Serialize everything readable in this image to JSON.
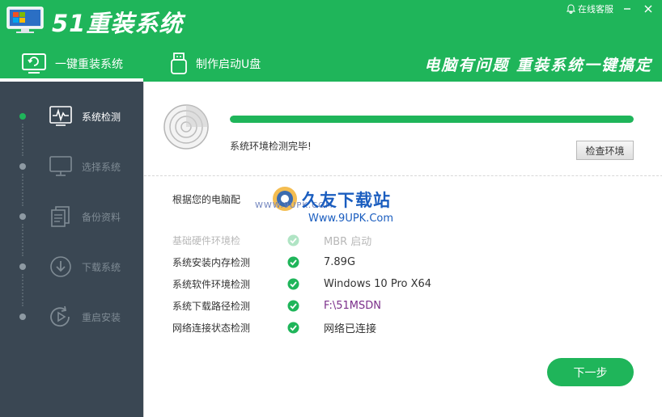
{
  "header": {
    "title": "51重装系统",
    "online_service": "在线客服",
    "slogan": "电脑有问题 重装系统一键搞定",
    "tabs": [
      {
        "label": "一键重装系统",
        "active": true
      },
      {
        "label": "制作启动U盘",
        "active": false
      }
    ]
  },
  "sidebar": {
    "steps": [
      {
        "label": "系统检测",
        "active": true,
        "icon": "pulse-monitor-icon"
      },
      {
        "label": "选择系统",
        "active": false,
        "icon": "monitor-icon"
      },
      {
        "label": "备份资料",
        "active": false,
        "icon": "documents-icon"
      },
      {
        "label": "下载系统",
        "active": false,
        "icon": "download-icon"
      },
      {
        "label": "重启安装",
        "active": false,
        "icon": "restart-icon"
      }
    ]
  },
  "detection": {
    "progress_percent": 100,
    "status_text": "系统环境检测完毕!",
    "check_button": "检查环境",
    "intro_text": "根据您的电脑配",
    "rows": [
      {
        "label": "基础硬件环境检",
        "value": "MBR 启动",
        "faded": true
      },
      {
        "label": "系统安装内存检测",
        "value": "7.89G",
        "faded": false
      },
      {
        "label": "系统软件环境检测",
        "value": "Windows 10 Pro X64",
        "faded": false
      },
      {
        "label": "系统下载路径检测",
        "value": "F:\\51MSDN",
        "faded": false,
        "is_path": true
      },
      {
        "label": "网络连接状态检测",
        "value": "网络已连接",
        "faded": false
      }
    ],
    "next_button": "下一步"
  },
  "watermark": {
    "url_small": "WWW.9UPK.COM",
    "name": "久友下载站",
    "url": "Www.9UPK.Com"
  },
  "colors": {
    "brand_green": "#1fb55a",
    "sidebar_bg": "#3a4753",
    "path_purple": "#7b2f8a"
  }
}
